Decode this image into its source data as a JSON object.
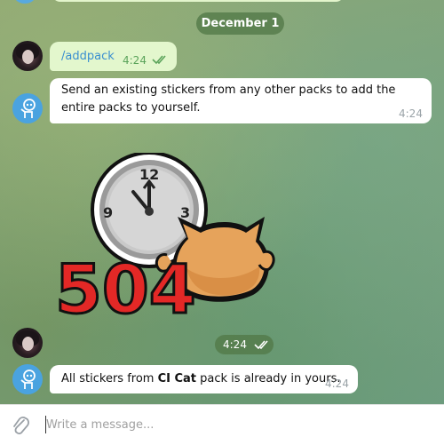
{
  "chat": {
    "date_label": "December 1",
    "messages": [
      {
        "id": "m1",
        "sender": "user",
        "text": "/addpack",
        "time": "4:24",
        "status": "read"
      },
      {
        "id": "m2",
        "sender": "bot",
        "text": "Send an existing stickers from any other packs to add the entire packs to yourself.",
        "time": "4:24"
      },
      {
        "id": "m3",
        "sender": "user",
        "type": "sticker",
        "sticker_text": "504",
        "clock_numbers": [
          "12",
          "3",
          "9"
        ],
        "time": "4:24",
        "status": "read"
      },
      {
        "id": "m4",
        "sender": "bot",
        "text_before": "All stickers from ",
        "text_bold": "CI Cat",
        "text_after": " pack is already in yours.",
        "time": "4:24"
      }
    ]
  },
  "composer": {
    "placeholder": "Write a message...",
    "attach_icon": "paperclip-icon"
  },
  "colors": {
    "outgoing_bubble": "#e3f7cd",
    "incoming_bubble": "#ffffff",
    "link": "#3a8fd0",
    "read_check": "#5aa35a",
    "bot_avatar": "#4aa3e0",
    "sticker_red": "#e32826",
    "sticker_cat": "#e6a35b"
  }
}
